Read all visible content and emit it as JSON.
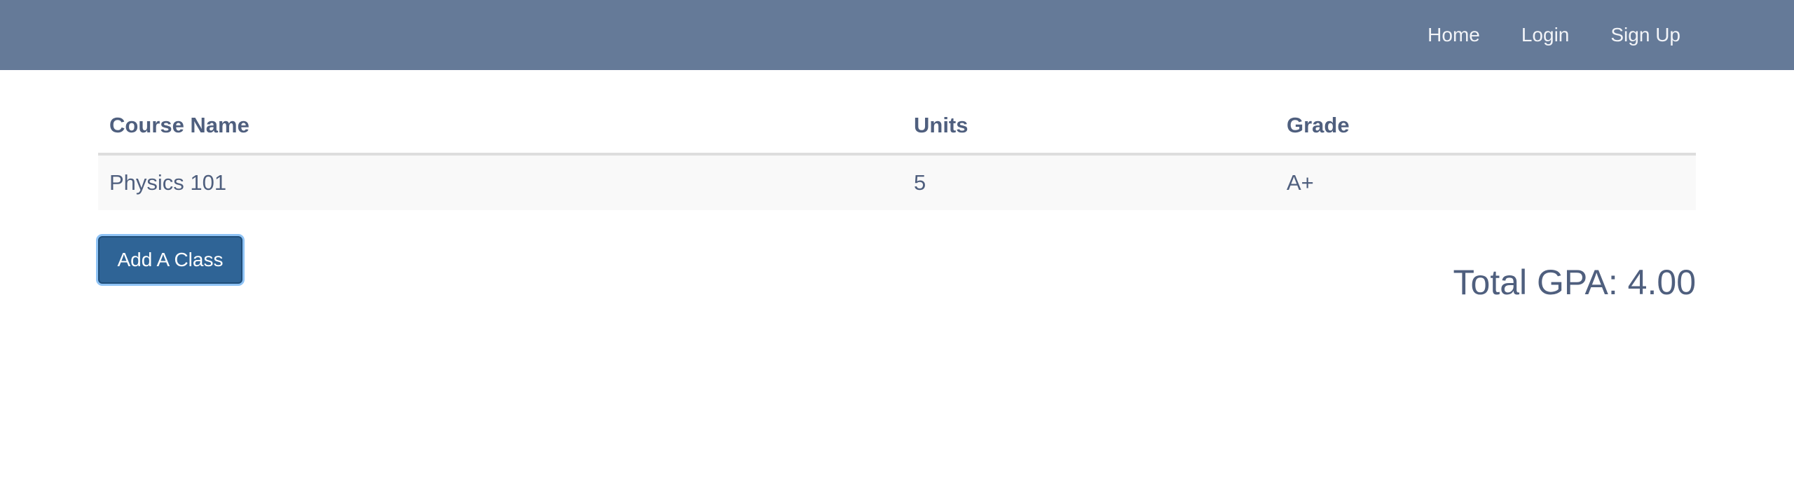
{
  "nav": {
    "links": [
      "Home",
      "Login",
      "Sign Up"
    ]
  },
  "table": {
    "headers": [
      "Course Name",
      "Units",
      "Grade"
    ],
    "rows": [
      [
        "Physics 101",
        "5",
        "A+"
      ]
    ]
  },
  "actions": {
    "add_class_label": "Add A Class"
  },
  "summary": {
    "total_gpa_label": "Total GPA: 4.00"
  },
  "colors": {
    "navbar": "#657a98",
    "text": "#4f5f7e",
    "button": "#2f6496",
    "button_focus_ring": "#8fc3f5"
  }
}
